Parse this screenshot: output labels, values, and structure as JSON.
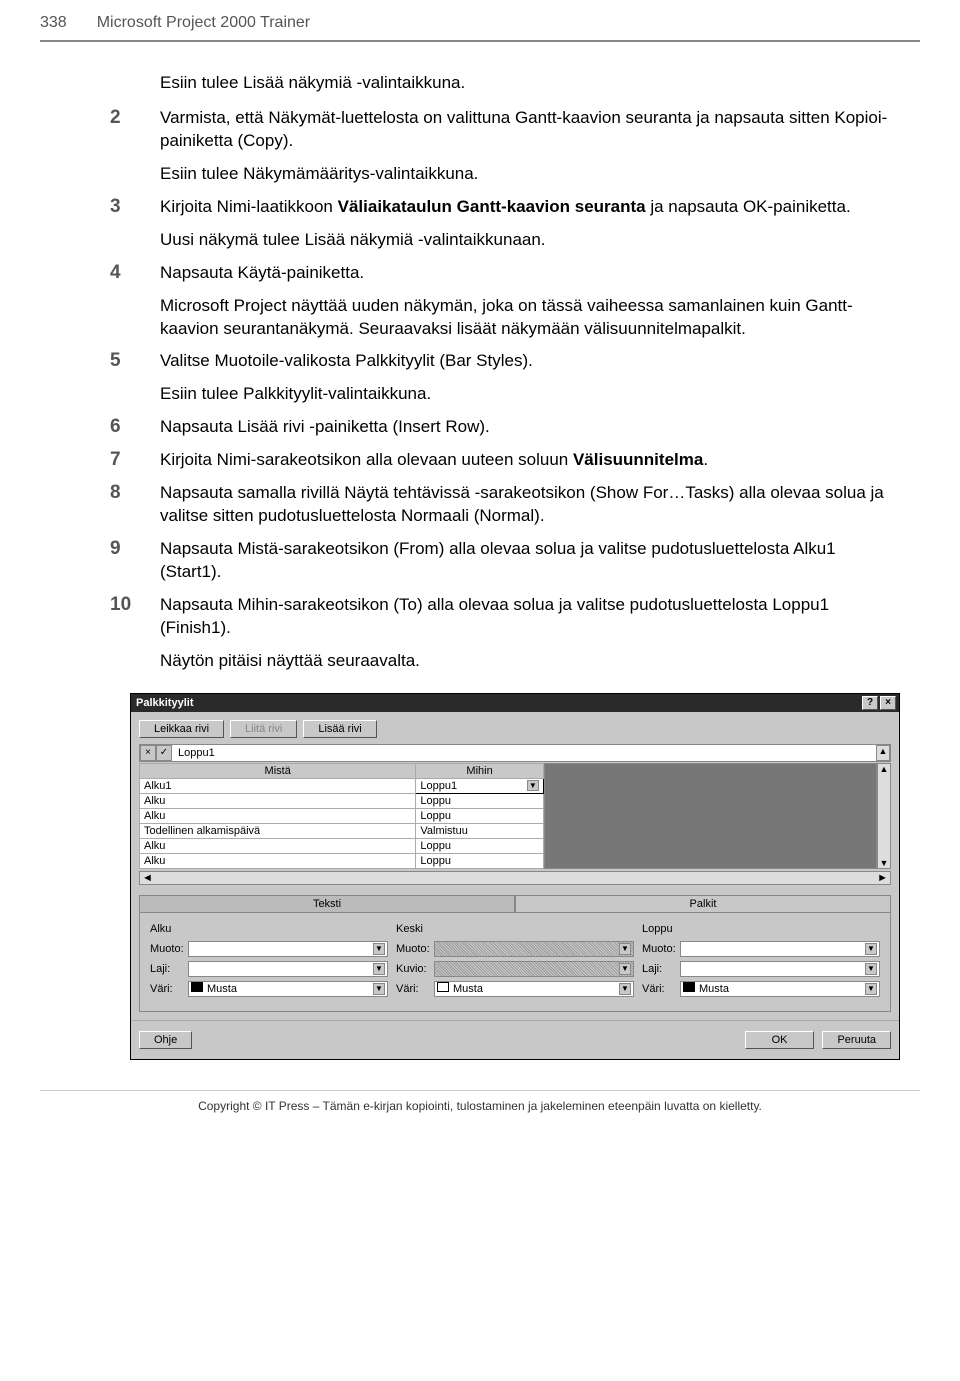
{
  "header": {
    "page_number": "338",
    "book_title": "Microsoft Project 2000 Trainer"
  },
  "intro": "Esiin tulee Lisää näkymiä -valintaikkuna.",
  "steps": [
    {
      "num": "2",
      "text": "Varmista, että Näkymät-luettelosta on valittuna Gantt-kaavion seuranta ja napsauta sitten Kopioi-painiketta (Copy).",
      "after": "Esiin tulee Näkymämääritys-valintaikkuna."
    },
    {
      "num": "3",
      "text_before": "Kirjoita Nimi-laatikkoon ",
      "bold": "Väliaikataulun Gantt-kaavion seuranta",
      "text_after": " ja napsauta OK-painiketta.",
      "after": "Uusi näkymä tulee Lisää näkymiä -valintaikkunaan."
    },
    {
      "num": "4",
      "text": "Napsauta Käytä-painiketta.",
      "after": "Microsoft Project näyttää uuden näkymän, joka on tässä vaiheessa samanlainen kuin Gantt-kaavion seurantanäkymä. Seuraavaksi lisäät näkymään välisuunnitelmapalkit."
    },
    {
      "num": "5",
      "text": "Valitse Muotoile-valikosta Palkkityylit (Bar Styles).",
      "after": "Esiin tulee Palkkityylit-valintaikkuna."
    },
    {
      "num": "6",
      "text": "Napsauta Lisää rivi -painiketta (Insert Row)."
    },
    {
      "num": "7",
      "text_before": "Kirjoita Nimi-sarakeotsikon alla olevaan uuteen soluun ",
      "bold": "Välisuunnitelma",
      "text_after": "."
    },
    {
      "num": "8",
      "text": "Napsauta samalla rivillä Näytä tehtävissä -sarakeotsikon (Show For…Tasks) alla olevaa solua ja valitse sitten pudotusluettelosta Normaali (Normal)."
    },
    {
      "num": "9",
      "text": "Napsauta Mistä-sarakeotsikon (From) alla olevaa solua ja valitse pudotusluettelosta Alku1 (Start1)."
    },
    {
      "num": "10",
      "text": "Napsauta Mihin-sarakeotsikon (To) alla olevaa solua ja valitse pudotusluettelosta Loppu1 (Finish1).",
      "after": "Näytön pitäisi näyttää seuraavalta."
    }
  ],
  "dialog": {
    "title": "Palkkityylit",
    "btn_cut": "Leikkaa rivi",
    "btn_paste": "Liitä rivi",
    "btn_insert": "Lisää rivi",
    "input_value": "Loppu1",
    "col_from": "Mistä",
    "col_to": "Mihin",
    "selected_cell": "Loppu1",
    "rows": [
      {
        "from": "Alku1",
        "to": "Loppu1",
        "selected": true
      },
      {
        "from": "Alku",
        "to": "Loppu"
      },
      {
        "from": "Alku",
        "to": "Loppu"
      },
      {
        "from": "Todellinen alkamispäivä",
        "to": "Valmistuu"
      },
      {
        "from": "Alku",
        "to": "Loppu"
      },
      {
        "from": "Alku",
        "to": "Loppu"
      }
    ],
    "tab_text": "Teksti",
    "tab_bars": "Palkit",
    "section_start": "Alku",
    "section_mid": "Keski",
    "section_end": "Loppu",
    "lbl_shape": "Muoto:",
    "lbl_type": "Laji:",
    "lbl_pattern": "Kuvio:",
    "lbl_color": "Väri:",
    "val_black": "Musta",
    "btn_help": "Ohje",
    "btn_ok": "OK",
    "btn_cancel": "Peruuta"
  },
  "copyright": "Copyright © IT Press – Tämän e-kirjan kopiointi, tulostaminen ja jakeleminen eteenpäin luvatta on kielletty."
}
